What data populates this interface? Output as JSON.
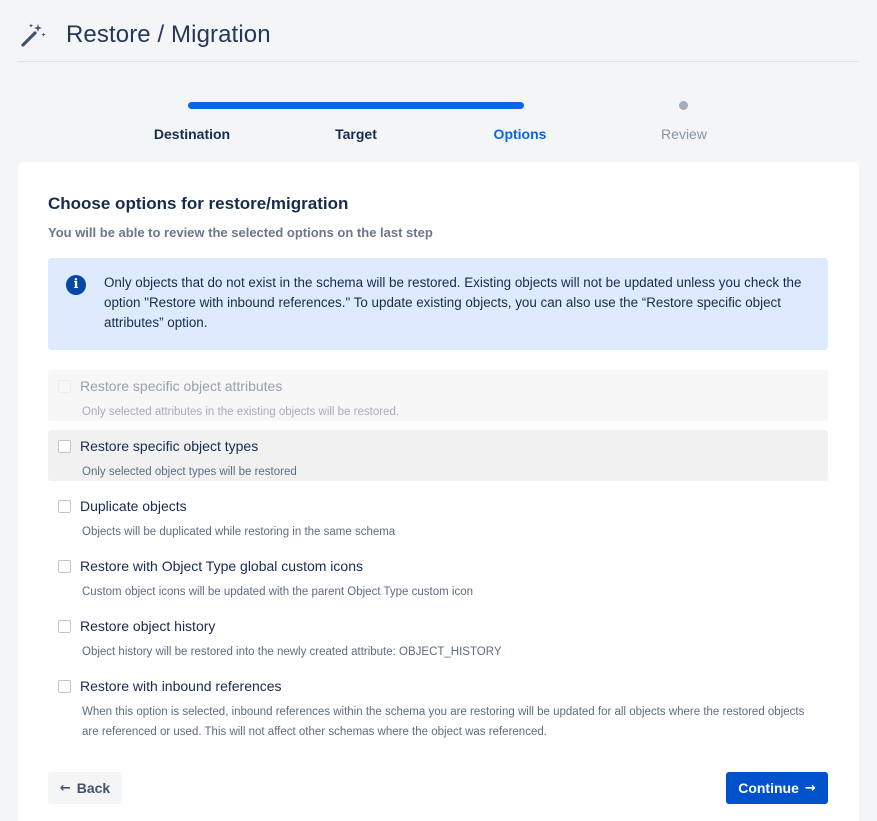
{
  "header": {
    "title": "Restore / Migration",
    "icon": "magic-wand-icon"
  },
  "stepper": {
    "progress": 0.75,
    "steps": [
      {
        "label": "Destination",
        "state": "done"
      },
      {
        "label": "Target",
        "state": "done"
      },
      {
        "label": "Options",
        "state": "active"
      },
      {
        "label": "Review",
        "state": "pending"
      }
    ]
  },
  "card": {
    "title": "Choose options for restore/migration",
    "subtitle": "You will be able to review the selected options on the last step"
  },
  "info": {
    "icon": "info-icon",
    "text": "Only objects that do not exist in the schema will be restored. Existing objects will not be updated unless you check the option \"Restore with inbound references.\" To update existing objects, you can also use the “Restore specific object attributes” option."
  },
  "options": [
    {
      "label": "Restore specific object attributes",
      "description": "Only selected attributes in the existing objects will be restored.",
      "disabled": true,
      "checked": false
    },
    {
      "label": "Restore specific object types",
      "description": "Only selected object types will be restored",
      "disabled": false,
      "checked": false
    },
    {
      "label": "Duplicate objects",
      "description": "Objects will be duplicated while restoring in the same schema",
      "disabled": false,
      "checked": false
    },
    {
      "label": "Restore with Object Type global custom icons",
      "description": "Custom object icons will be updated with the parent Object Type custom icon",
      "disabled": false,
      "checked": false
    },
    {
      "label": "Restore object history",
      "description": "Object history will be restored into the newly created attribute: OBJECT_HISTORY",
      "disabled": false,
      "checked": false
    },
    {
      "label": "Restore with inbound references",
      "description": "When this option is selected, inbound references within the schema you are restoring will be updated for all objects where the restored objects are referenced or used. This will not affect other schemas where the object was referenced.",
      "disabled": false,
      "checked": false
    }
  ],
  "actions": {
    "back_label": "Back",
    "continue_label": "Continue"
  },
  "colors": {
    "primary": "#0052cc",
    "active_step": "#0c66e4",
    "info_bg": "#deebff"
  }
}
